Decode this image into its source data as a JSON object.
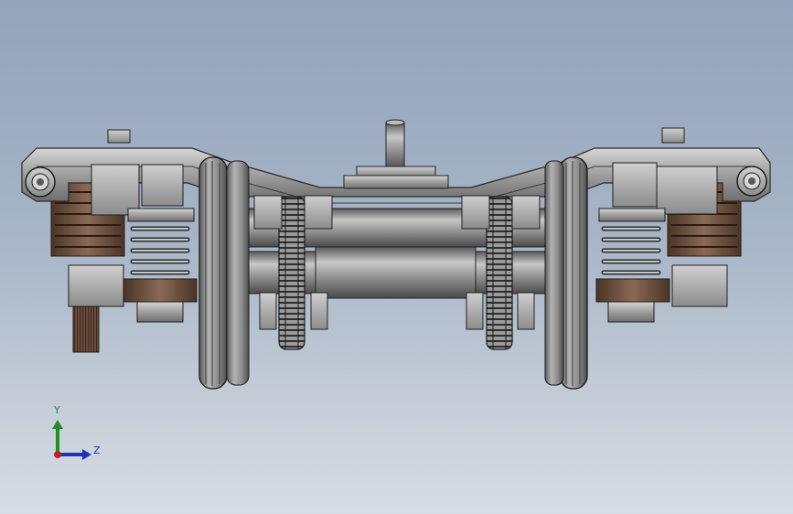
{
  "viewport": {
    "model": "bogie-assembly",
    "view": "right",
    "background_top": "#93a4bb",
    "background_bottom": "#d8dde4"
  },
  "triad": {
    "y_label": "Y",
    "z_label": "Z",
    "y_color": "#2a8a2a",
    "z_color": "#2030c0",
    "x_color": "#c02020"
  }
}
